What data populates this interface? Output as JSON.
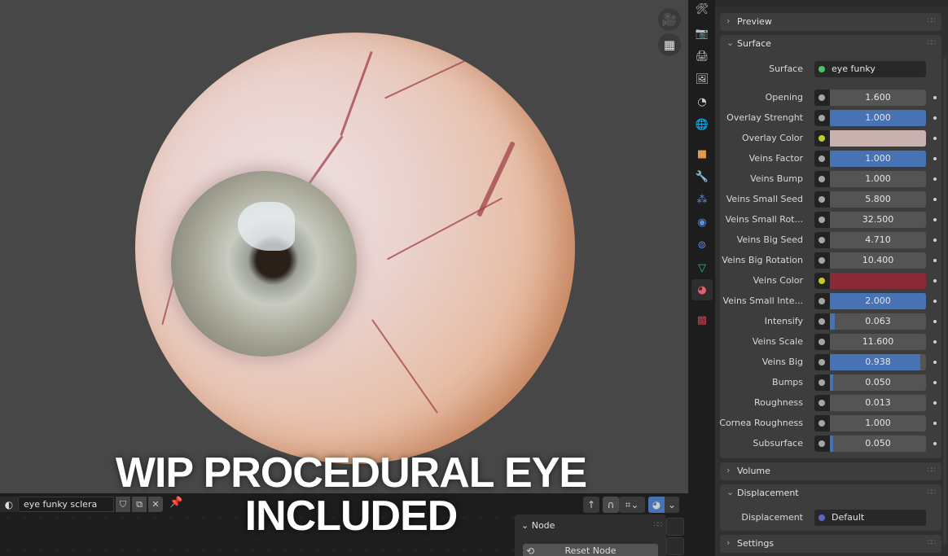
{
  "caption": {
    "line1": "WIP PROCEDURAL EYE",
    "line2": "INCLUDED"
  },
  "viewport": {
    "buttons": [
      {
        "name": "camera-view-button",
        "icon": "camera-icon",
        "glyph": "🎥"
      },
      {
        "name": "ortho-grid-button",
        "icon": "grid-icon",
        "glyph": "▦"
      }
    ]
  },
  "node_editor": {
    "material_name": "eye funky sclera",
    "material_type_glyph": "◐",
    "buttons": {
      "fake_user": "⛉",
      "duplicate": "⧉",
      "unlink": "✕",
      "pin": "📌"
    },
    "toolbar": {
      "parent": "↑",
      "snap": "∩",
      "snap_mode": "⌗",
      "shading": "◕",
      "dropdown": "⌄"
    },
    "sidebar_panel": {
      "title": "Node",
      "reset_label": "Reset Node",
      "reset_icon": "⟲"
    }
  },
  "tabbar": [
    {
      "name": "tool-tab",
      "glyph": "🛠",
      "color": "#cfcfcf"
    },
    {
      "name": "render-tab",
      "glyph": "📷",
      "color": "#cfcfcf"
    },
    {
      "name": "output-tab",
      "glyph": "🖨",
      "color": "#cfcfcf"
    },
    {
      "name": "view-layer-tab",
      "glyph": "🖼",
      "color": "#cfcfcf"
    },
    {
      "name": "scene-tab",
      "glyph": "◔",
      "color": "#cfcfcf"
    },
    {
      "name": "world-tab",
      "glyph": "🌐",
      "color": "#d0505a"
    },
    {
      "name": "object-tab",
      "glyph": "■",
      "color": "#e09a4a"
    },
    {
      "name": "modifier-tab",
      "glyph": "🔧",
      "color": "#5a8ee0"
    },
    {
      "name": "particles-tab",
      "glyph": "⁂",
      "color": "#5a8ee0"
    },
    {
      "name": "physics-tab",
      "glyph": "◉",
      "color": "#5a8ee0"
    },
    {
      "name": "constraints-tab",
      "glyph": "⊚",
      "color": "#5a8ee0"
    },
    {
      "name": "data-tab",
      "glyph": "▽",
      "color": "#30c080"
    },
    {
      "name": "material-tab",
      "glyph": "◕",
      "color": "#e06070",
      "active": true
    },
    {
      "name": "texture-tab",
      "glyph": "▩",
      "color": "#c04050"
    }
  ],
  "properties": {
    "panels": {
      "preview": {
        "title": "Preview",
        "expanded": false
      },
      "surface": {
        "title": "Surface",
        "expanded": true
      },
      "volume": {
        "title": "Volume",
        "expanded": false
      },
      "displacement": {
        "title": "Displacement",
        "expanded": true
      },
      "settings": {
        "title": "Settings",
        "expanded": false
      }
    },
    "surface_shader": {
      "label": "Surface",
      "value": "eye funky",
      "socket_color": "#4fc35f"
    },
    "inputs": [
      {
        "label": "Opening",
        "value": "1.600",
        "fill": 0,
        "socket": "#a5a5a5"
      },
      {
        "label": "Overlay Strenght",
        "value": "1.000",
        "fill": 1.0,
        "socket": "#a5a5a5"
      },
      {
        "label": "Overlay Color",
        "value": "",
        "color": "#c9b1b0",
        "socket": "#c7c729"
      },
      {
        "label": "Veins Factor",
        "value": "1.000",
        "fill": 1.0,
        "socket": "#a5a5a5"
      },
      {
        "label": "Veins Bump",
        "value": "1.000",
        "fill": 0,
        "socket": "#a5a5a5"
      },
      {
        "label": "Veins Small Seed",
        "value": "5.800",
        "fill": 0,
        "socket": "#a5a5a5"
      },
      {
        "label": "Veins Small Rot...",
        "value": "32.500",
        "fill": 0,
        "socket": "#a5a5a5"
      },
      {
        "label": "Veins Big Seed",
        "value": "4.710",
        "fill": 0,
        "socket": "#a5a5a5"
      },
      {
        "label": "Veins Big Rotation",
        "value": "10.400",
        "fill": 0,
        "socket": "#a5a5a5"
      },
      {
        "label": "Veins Color",
        "value": "",
        "color": "#8a2a38",
        "socket": "#c7c729"
      },
      {
        "label": "Veins Small Inte...",
        "value": "2.000",
        "fill": 1.0,
        "socket": "#a5a5a5"
      },
      {
        "label": "Intensify",
        "value": "0.063",
        "fill": 0.05,
        "socket": "#a5a5a5"
      },
      {
        "label": "Veins Scale",
        "value": "11.600",
        "fill": 0,
        "socket": "#a5a5a5"
      },
      {
        "label": "Veins Big",
        "value": "0.938",
        "fill": 0.938,
        "socket": "#a5a5a5"
      },
      {
        "label": "Bumps",
        "value": "0.050",
        "fill": 0.03,
        "socket": "#a5a5a5"
      },
      {
        "label": "Roughness",
        "value": "0.013",
        "fill": 0,
        "socket": "#a5a5a5"
      },
      {
        "label": "Cornea Roughness",
        "value": "1.000",
        "fill": 0,
        "socket": "#a5a5a5"
      },
      {
        "label": "Subsurface",
        "value": "0.050",
        "fill": 0.03,
        "socket": "#a5a5a5"
      }
    ],
    "displacement": {
      "label": "Displacement",
      "value": "Default",
      "socket_color": "#6363c7"
    }
  },
  "colors": {
    "accent": "#4772b3",
    "viewport_bg": "#474747",
    "panel_bg": "#3d3d3d"
  }
}
